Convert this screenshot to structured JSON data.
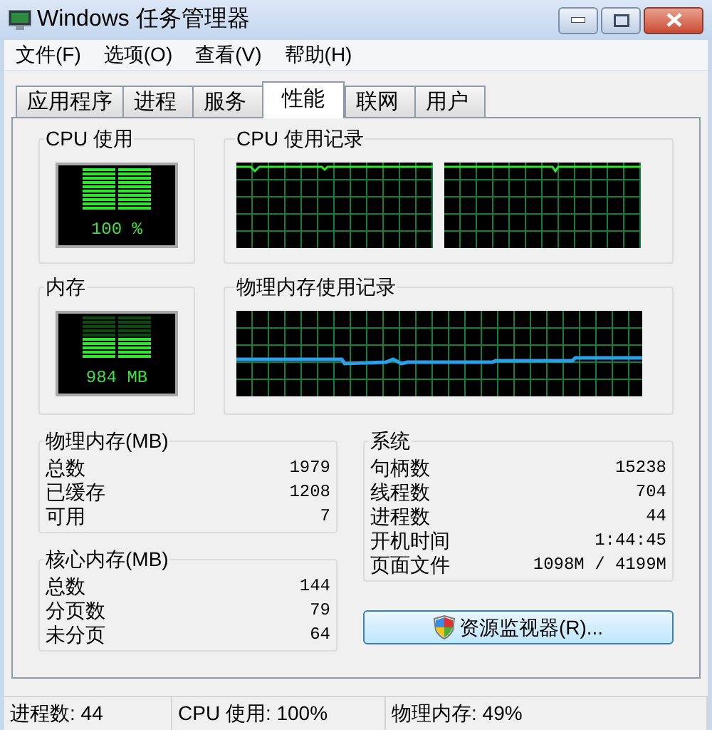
{
  "window": {
    "title": "Windows 任务管理器"
  },
  "menu": [
    "文件(F)",
    "选项(O)",
    "查看(V)",
    "帮助(H)"
  ],
  "tabs": [
    {
      "label": "应用程序",
      "selected": false
    },
    {
      "label": "进程",
      "selected": false
    },
    {
      "label": "服务",
      "selected": false
    },
    {
      "label": "性能",
      "selected": true
    },
    {
      "label": "联网",
      "selected": false
    },
    {
      "label": "用户",
      "selected": false
    }
  ],
  "cpu_usage": {
    "title": "CPU 使用",
    "reading": "100 %"
  },
  "cpu_history": {
    "title": "CPU 使用记录"
  },
  "memory": {
    "title": "内存",
    "reading": "984 MB"
  },
  "memory_history": {
    "title": "物理内存使用记录"
  },
  "physical_memory": {
    "title": "物理内存(MB)",
    "rows": [
      {
        "label": "总数",
        "value": "1979"
      },
      {
        "label": "已缓存",
        "value": "1208"
      },
      {
        "label": "可用",
        "value": "7"
      }
    ]
  },
  "kernel_memory": {
    "title": "核心内存(MB)",
    "rows": [
      {
        "label": "总数",
        "value": "144"
      },
      {
        "label": "分页数",
        "value": "79"
      },
      {
        "label": "未分页",
        "value": "64"
      }
    ]
  },
  "system": {
    "title": "系统",
    "rows": [
      {
        "label": "句柄数",
        "value": "15238"
      },
      {
        "label": "线程数",
        "value": "704"
      },
      {
        "label": "进程数",
        "value": "44"
      },
      {
        "label": "开机时间",
        "value": "1:44:45"
      },
      {
        "label": "页面文件",
        "value": "1098M / 4199M"
      }
    ]
  },
  "resource_monitor_button": "资源监视器(R)...",
  "status_bar": [
    "进程数: 44",
    "CPU 使用: 100%",
    "物理内存: 49%"
  ]
}
